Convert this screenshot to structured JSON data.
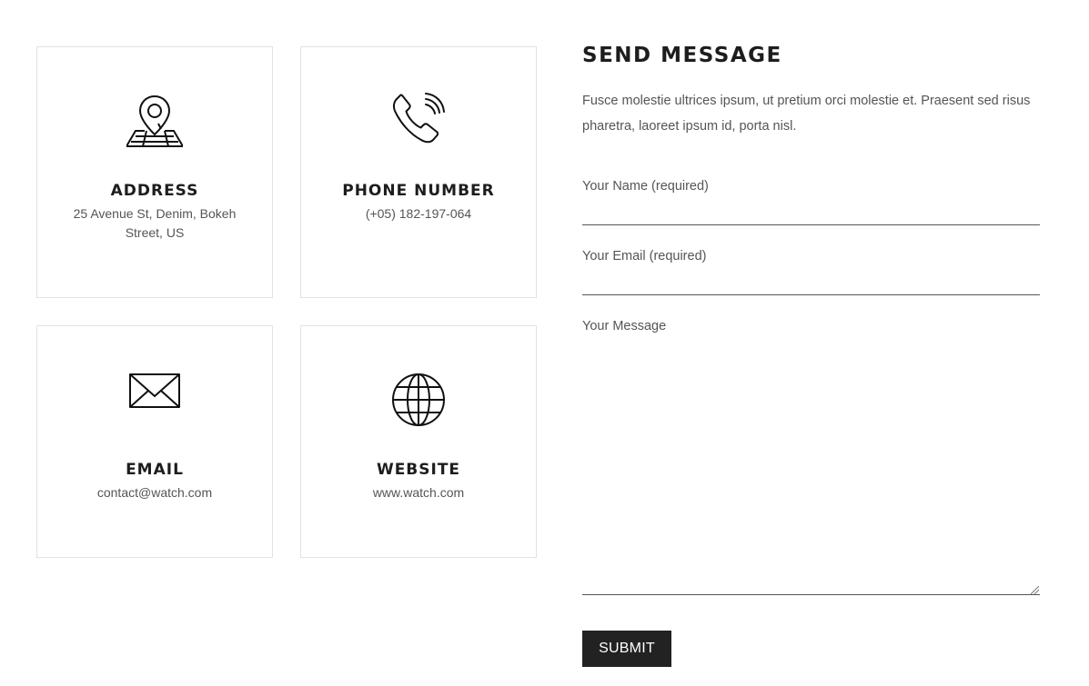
{
  "contact_cards": {
    "address": {
      "icon": "map-pin-icon",
      "title": "ADDRESS",
      "value": "25 Avenue St, Denim, Bokeh Street, US"
    },
    "phone": {
      "icon": "phone-icon",
      "title": "PHONE NUMBER",
      "value": "(+05) 182-197-064"
    },
    "email": {
      "icon": "envelope-icon",
      "title": "EMAIL",
      "value": "contact@watch.com"
    },
    "website": {
      "icon": "globe-icon",
      "title": "WEBSITE",
      "value": "www.watch.com"
    }
  },
  "form": {
    "title": "SEND MESSAGE",
    "description": "Fusce molestie ultrices ipsum, ut pretium orci molestie et. Praesent sed risus pharetra, laoreet ipsum id, porta nisl.",
    "name_label": "Your Name (required)",
    "name_value": "",
    "email_label": "Your Email (required)",
    "email_value": "",
    "message_label": "Your Message",
    "message_value": "",
    "submit_label": "SUBMIT"
  },
  "colors": {
    "text_dark": "#1d1d1d",
    "text_muted": "#555555",
    "card_border": "#e2e2e2",
    "button_bg": "#222222",
    "button_text": "#ffffff"
  }
}
